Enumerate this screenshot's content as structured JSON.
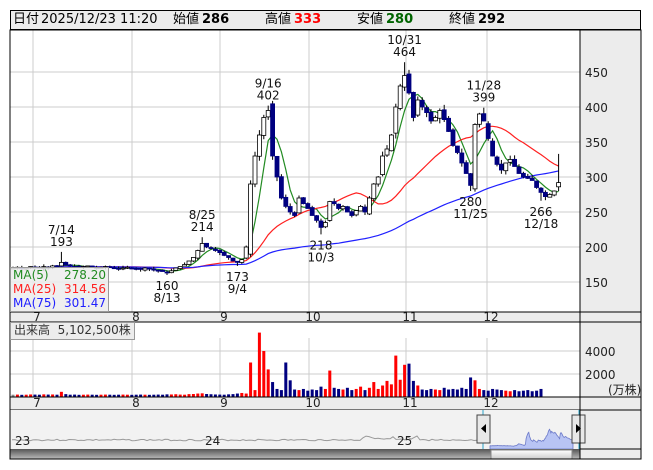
{
  "header": {
    "date_label": "日付",
    "date": "2025/12/23 11:20",
    "open_label": "始値",
    "open": "286",
    "high_label": "高値",
    "high": "333",
    "low_label": "安値",
    "low": "280",
    "close_label": "終値",
    "close": "292"
  },
  "legend": {
    "ma5_label": "MA(5)",
    "ma5": "278.20",
    "ma25_label": "MA(25)",
    "ma25": "314.56",
    "ma75_label": "MA(75)",
    "ma75": "301.47"
  },
  "volume_label": "出来高",
  "volume_value": "5,102,500株",
  "colors": {
    "up": "#ff0000",
    "down": "#000080",
    "flat": "#888888",
    "ma5": "#228b22",
    "ma25": "#ff2020",
    "ma75": "#2020ff",
    "high": "#ff0000",
    "low": "#006400"
  },
  "chart_data": {
    "type": "candlestick",
    "price_axis": {
      "ticks": [
        "150",
        "200",
        "250",
        "300",
        "350",
        "400",
        "450"
      ],
      "range": [
        100,
        500
      ]
    },
    "volume_axis": {
      "ticks": [
        "2000",
        "4000"
      ],
      "unit": "(万株)"
    },
    "month_labels": [
      "7",
      "8",
      "9",
      "10",
      "11",
      "12"
    ],
    "navigator_labels": [
      "23",
      "24",
      "25"
    ],
    "closes": [
      170,
      171,
      169,
      170,
      172,
      171,
      170,
      172,
      171,
      173,
      172,
      178,
      174,
      173,
      172,
      171,
      172,
      173,
      171,
      170,
      171,
      172,
      171,
      170,
      169,
      170,
      171,
      170,
      169,
      168,
      170,
      169,
      167,
      166,
      165,
      163,
      166,
      170,
      172,
      175,
      180,
      185,
      195,
      205,
      200,
      198,
      195,
      192,
      188,
      185,
      180,
      178,
      182,
      200,
      290,
      330,
      360,
      385,
      395,
      330,
      300,
      270,
      258,
      250,
      245,
      270,
      262,
      255,
      245,
      238,
      228,
      235,
      265,
      262,
      255,
      258,
      250,
      245,
      252,
      258,
      250,
      270,
      290,
      300,
      330,
      340,
      360,
      400,
      430,
      445,
      420,
      385,
      410,
      400,
      392,
      380,
      385,
      395,
      382,
      365,
      345,
      335,
      320,
      305,
      288,
      375,
      390,
      380,
      355,
      330,
      318,
      310,
      320,
      325,
      315,
      305,
      300,
      298,
      295,
      285,
      278,
      272,
      275,
      280,
      292
    ],
    "volumes": [
      200,
      210,
      190,
      200,
      220,
      210,
      200,
      230,
      210,
      220,
      200,
      450,
      250,
      200,
      210,
      190,
      200,
      210,
      200,
      190,
      200,
      210,
      200,
      190,
      200,
      210,
      200,
      190,
      200,
      210,
      200,
      190,
      200,
      210,
      200,
      230,
      220,
      240,
      210,
      200,
      250,
      260,
      300,
      320,
      260,
      240,
      220,
      210,
      200,
      230,
      250,
      300,
      350,
      300,
      3000,
      600,
      5600,
      4000,
      2400,
      1300,
      700,
      600,
      3000,
      1450,
      650,
      600,
      700,
      550,
      650,
      600,
      900,
      700,
      2300,
      800,
      700,
      650,
      800,
      600,
      700,
      900,
      600,
      800,
      1300,
      700,
      1000,
      1400,
      1100,
      3600,
      1500,
      2800,
      2900,
      1400,
      1000,
      650,
      600,
      700,
      650,
      600,
      800,
      650,
      700,
      650,
      800,
      700,
      1700,
      1450,
      700,
      600,
      550,
      700,
      650,
      600,
      550,
      500,
      600,
      500,
      550,
      600,
      500,
      550,
      700
    ],
    "annotations": [
      {
        "day_index": 11,
        "date": "7/14",
        "value": "193",
        "type": "high"
      },
      {
        "day_index": 35,
        "date": "8/13",
        "value": "160",
        "type": "low"
      },
      {
        "day_index": 43,
        "date": "8/25",
        "value": "214",
        "type": "high"
      },
      {
        "day_index": 51,
        "date": "9/4",
        "value": "173",
        "type": "low"
      },
      {
        "day_index": 58,
        "date": "9/16",
        "value": "402",
        "type": "high"
      },
      {
        "day_index": 70,
        "date": "10/3",
        "value": "218",
        "type": "low"
      },
      {
        "day_index": 89,
        "date": "10/31",
        "value": "464",
        "type": "high"
      },
      {
        "day_index": 104,
        "date": "11/25",
        "value": "280",
        "type": "low"
      },
      {
        "day_index": 107,
        "date": "11/28",
        "value": "399",
        "type": "high"
      },
      {
        "day_index": 120,
        "date": "12/18",
        "value": "266",
        "type": "low"
      }
    ],
    "last_bar": {
      "open": 286,
      "high": 333,
      "low": 280,
      "close": 292
    }
  }
}
